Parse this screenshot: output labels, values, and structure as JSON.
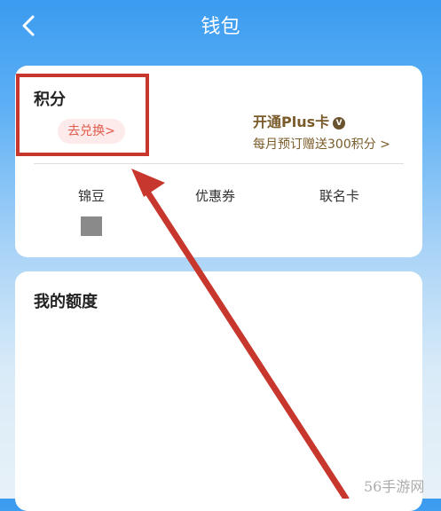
{
  "header": {
    "title": "钱包"
  },
  "points": {
    "label": "积分",
    "redeem_label": "去兑换>"
  },
  "plus": {
    "title": "开通Plus卡",
    "badge": "V",
    "subtitle": "每月预订赠送300积分 >"
  },
  "tabs": [
    {
      "label": "锦豆"
    },
    {
      "label": "优惠券"
    },
    {
      "label": "联名卡"
    }
  ],
  "quota": {
    "label": "我的额度"
  },
  "watermark": "56手游网",
  "colors": {
    "accent_red": "#c8372d",
    "gold_text": "#7a5b2a",
    "header_blue": "#3b9bf0"
  }
}
